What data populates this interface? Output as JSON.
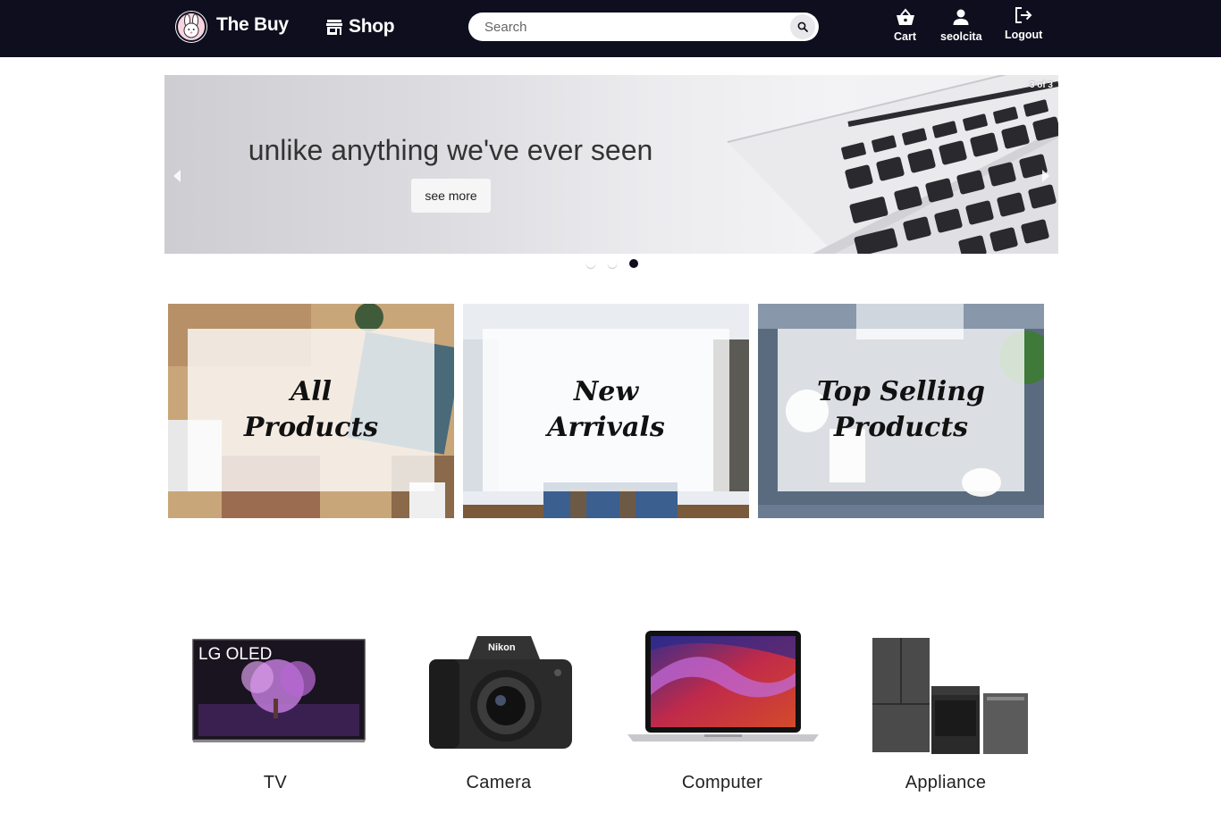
{
  "nav": {
    "brand": "The Buy",
    "shop_label": "Shop",
    "search_placeholder": "Search",
    "cart_label": "Cart",
    "user_label": "seolcita",
    "logout_label": "Logout"
  },
  "carousel": {
    "counter": "3 of 3",
    "headline": "unlike anything we've ever seen",
    "button_label": "see more",
    "active_slide": 3,
    "total_slides": 3
  },
  "tiles": [
    {
      "label": "All\nProducts"
    },
    {
      "label": "New\nArrivals"
    },
    {
      "label": "Top Selling\nProducts"
    }
  ],
  "categories": [
    {
      "label": "TV",
      "icon": "tv-image"
    },
    {
      "label": "Camera",
      "icon": "camera-image"
    },
    {
      "label": "Computer",
      "icon": "laptop-image"
    },
    {
      "label": "Appliance",
      "icon": "appliance-image"
    }
  ],
  "tv_brand_text": "LG OLED",
  "camera_brand_text": "Nikon",
  "colors": {
    "navbar": "#0f0e1f",
    "accent": "#0f0e1f"
  }
}
